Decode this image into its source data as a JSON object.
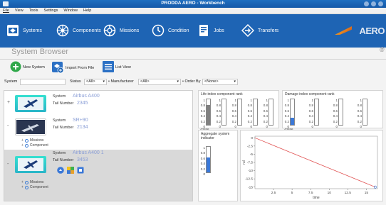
{
  "window": {
    "title": "PRODDA AERO - Workbench"
  },
  "menu": [
    "File",
    "View",
    "Tools",
    "Settings",
    "Window",
    "Help"
  ],
  "nav": [
    {
      "label": "Systems",
      "icon": "systems-icon"
    },
    {
      "label": "Components",
      "icon": "components-icon"
    },
    {
      "label": "Missions",
      "icon": "missions-icon"
    },
    {
      "label": "Condition",
      "icon": "condition-icon"
    },
    {
      "label": "Jobs",
      "icon": "jobs-icon"
    },
    {
      "label": "Transfers",
      "icon": "transfers-icon"
    }
  ],
  "brand": {
    "logo_text": "AERO"
  },
  "page": {
    "title": "System Browser",
    "hash": "@"
  },
  "toolbar": {
    "new_system": "New System",
    "import": "Import From File",
    "list_view": "List View"
  },
  "filters": {
    "system_label": "System",
    "status_label": "Status",
    "status_value": "<All>",
    "manufacturer_label": "Manufacturer",
    "manufacturer_value": "<All>",
    "order_label": "Order By",
    "order_value": "<None>"
  },
  "systems": [
    {
      "system_label": "System",
      "name": "Airbus A400",
      "tail_label": "Tail Number",
      "tail": "2345",
      "expander": "+"
    },
    {
      "system_label": "System",
      "name": "SR+90",
      "tail_label": "Tail Number",
      "tail": "2134",
      "expander": "-",
      "subs": [
        "Missions",
        "Component"
      ]
    },
    {
      "system_label": "System",
      "name": "Airbus A400 1",
      "tail_label": "Tail Number",
      "tail": "3453",
      "expander": "-",
      "subs": [
        "Missions",
        "Component"
      ]
    }
  ],
  "life_chart": {
    "title": "Life index component rank",
    "ticks": [
      "1",
      "0.8",
      "0.6",
      "0.4",
      "0.2",
      "0"
    ],
    "gauges": [
      {
        "label": "43556",
        "value": 0.78
      },
      {
        "label": "",
        "value": 0
      },
      {
        "label": "",
        "value": 0
      },
      {
        "label": "",
        "value": 0
      },
      {
        "label": "",
        "value": 0
      }
    ]
  },
  "damage_chart": {
    "title": "Damage index component rank",
    "ticks": [
      "1",
      "0.8",
      "0.6",
      "0.4",
      "0.2",
      "0"
    ],
    "gauges": [
      {
        "label": "43556",
        "value": 0.27
      },
      {
        "label": "",
        "value": 0
      },
      {
        "label": "",
        "value": 0
      },
      {
        "label": "",
        "value": 0
      }
    ]
  },
  "aggregate": {
    "title": "Aggregate system indicator",
    "ticks": [
      "1",
      "0.8",
      "0.6",
      "0.4",
      "0.2",
      "0"
    ],
    "value": 0.58
  },
  "rul_chart": {
    "ylabel": "rul",
    "xlabel": "time",
    "yticks": [
      "0",
      "-2.5",
      "-5",
      "-7.5",
      "-10",
      "-12.5",
      "-15"
    ],
    "xticks": [
      "2.5",
      "5",
      "7.5",
      "10",
      "12.5",
      "15"
    ],
    "series_color": "#e05050"
  },
  "colors": {
    "navbar": "#1e64b4",
    "accent_cyan": "#35e0d0",
    "gauge_fill": "#808080",
    "aggregate_fill": "#3a78d8"
  }
}
